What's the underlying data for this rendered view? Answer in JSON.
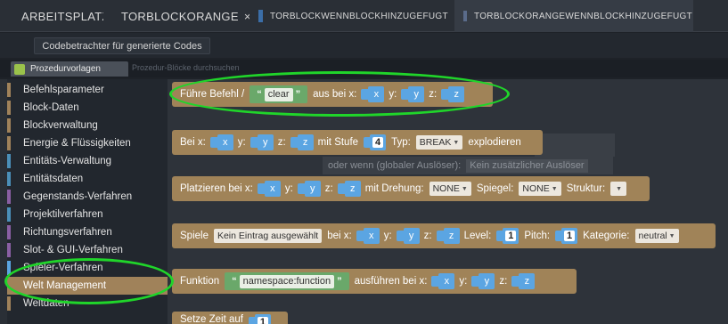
{
  "tabs": [
    {
      "label": "ARBEITSPLATZ",
      "icon": "none",
      "closable": false,
      "active": false
    },
    {
      "label": "TORBLOCKORANGE",
      "icon": "cube-icon",
      "closable": true,
      "active": false
    },
    {
      "label": "TORBLOCKWENNBLOCKHINZUGEFUGT",
      "icon": "document-icon",
      "closable": true,
      "active": false
    },
    {
      "label": "TORBLOCKORANGEWENNBLOCKHINZUGEFUGT",
      "icon": "document-icon",
      "closable": true,
      "active": true
    }
  ],
  "close_glyph": "×",
  "code_viewer": {
    "label": "Codebetrachter für generierte Codes"
  },
  "palette_tabs": {
    "active": "Prozedurvorlagen",
    "inactive": "Prozedur-Blöcke durchsuchen"
  },
  "sidebar": {
    "items": [
      {
        "label": "Befehlsparameter",
        "color": "#a0825a",
        "selected": false
      },
      {
        "label": "Block-Daten",
        "color": "#a0825a",
        "selected": false
      },
      {
        "label": "Blockverwaltung",
        "color": "#a0825a",
        "selected": false
      },
      {
        "label": "Energie & Flüssigkeiten",
        "color": "#a0825a",
        "selected": false
      },
      {
        "label": "Entitäts-Verwaltung",
        "color": "#4b8fb8",
        "selected": false
      },
      {
        "label": "Entitätsdaten",
        "color": "#4b8fb8",
        "selected": false
      },
      {
        "label": "Gegenstands-Verfahren",
        "color": "#8a5fa3",
        "selected": false
      },
      {
        "label": "Projektilverfahren",
        "color": "#4b8fb8",
        "selected": false
      },
      {
        "label": "Richtungsverfahren",
        "color": "#8a5fa3",
        "selected": false
      },
      {
        "label": "Slot- & GUI-Verfahren",
        "color": "#8a5fa3",
        "selected": false
      },
      {
        "label": "Spieler-Verfahren",
        "color": "#5ba5e2",
        "selected": false
      },
      {
        "label": "Welt Management",
        "color": "#a0825a",
        "selected": true
      },
      {
        "label": "Weltdaten",
        "color": "#a0825a",
        "selected": false
      }
    ]
  },
  "blocks": {
    "command": {
      "label": "Führe Befehl /",
      "string_value": "clear",
      "at_label": "aus bei x:",
      "x": "x",
      "y_label": "y:",
      "y": "y",
      "z_label": "z:",
      "z": "z"
    },
    "explode": {
      "label": "Bei x:",
      "x": "x",
      "y_label": "y:",
      "y": "y",
      "z_label": "z:",
      "z": "z",
      "power_label": "mit Stufe",
      "power": "4",
      "type_label": "Typ:",
      "type_value": "BREAK",
      "suffix": "explodieren"
    },
    "structure": {
      "label": "Platzieren bei x:",
      "x": "x",
      "y_label": "y:",
      "y": "y",
      "z_label": "z:",
      "z": "z",
      "rotation_label": "mit Drehung:",
      "rotation": "NONE",
      "mirror_label": "Spiegel:",
      "mirror": "NONE",
      "structure_label": "Struktur:"
    },
    "sound": {
      "label": "Spiele",
      "sound_value": "Kein Eintrag ausgewählt",
      "at_label": "bei x:",
      "x": "x",
      "y_label": "y:",
      "y": "y",
      "z_label": "z:",
      "z": "z",
      "level_label": "Level:",
      "level": "1",
      "pitch_label": "Pitch:",
      "pitch": "1",
      "category_label": "Kategorie:",
      "category": "neutral"
    },
    "function": {
      "label": "Funktion",
      "string_value": "namespace:function",
      "at_label": "ausführen bei x:",
      "x": "x",
      "y_label": "y:",
      "y": "y",
      "z_label": "z:",
      "z": "z"
    },
    "time": {
      "label": "Setze Zeit auf",
      "value": "1"
    }
  },
  "ghost": {
    "text": "oder wenn (globaler Auslöser):",
    "field": "Kein zusätzlicher Auslöser"
  },
  "colors": {
    "block": "#a08358",
    "variable": "#5ba5e2",
    "string_block": "#6aa86a",
    "annotation": "#20d52a"
  }
}
